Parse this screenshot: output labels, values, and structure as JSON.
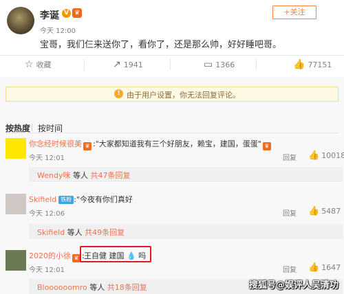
{
  "post": {
    "author": "李诞",
    "verified_badge": "V",
    "crown_badge": "♛",
    "time": "今天 12:00",
    "follow_label": "+关注",
    "text": "宝哥，我们仨来送你了，看你了，还是那么帅，好好睡吧哥。"
  },
  "actions": {
    "collect": "收藏",
    "repost": "1941",
    "comments": "1366",
    "likes": "77151",
    "icons": [
      "star-icon",
      "repost-icon",
      "comment-icon",
      "thumbs-up-icon"
    ]
  },
  "notice": {
    "text": "由于用户设置，你无法回复评论。",
    "icon": "!"
  },
  "sort": {
    "hot": "按热度",
    "time": "按时间"
  },
  "comments": [
    {
      "user": "你念经时候很美",
      "text": "\"大家都知道我有三个好朋友，赖宝，建国，蛋蛋\"",
      "time": "今天 12:01",
      "reply_label": "回复",
      "likes": "10018",
      "sub_user": "Wendy咪",
      "sub_mid": "等人",
      "sub_link": "共47条回复",
      "avatar_color": "#ffe600"
    },
    {
      "user": "Skifield",
      "vip_label": "铁粉",
      "text": "\"今夜有你们真好",
      "time": "今天 12:06",
      "reply_label": "回复",
      "likes": "5487",
      "sub_user": "Skifield",
      "sub_mid": "等人",
      "sub_link": "共49条回复",
      "avatar_color": "#cfc7c4"
    },
    {
      "user": "2020的小徐",
      "text": "王自健 建国 💧 吗",
      "time": "今天 12:01",
      "reply_label": "回复",
      "likes": "1647",
      "sub_user": "Bloooooomro",
      "sub_mid": "等人",
      "sub_link": "共18条回复",
      "avatar_color": "#6b7a55"
    }
  ],
  "watermark": "搜狐号@娱评人吴清功"
}
